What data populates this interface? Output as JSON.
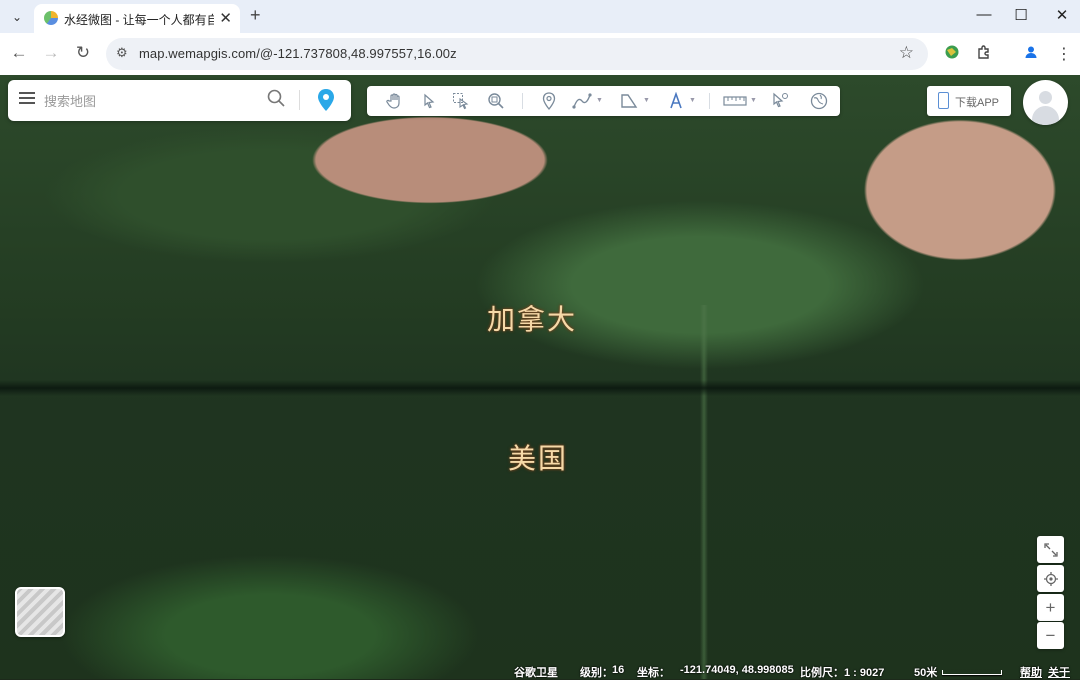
{
  "browser": {
    "tab_title": "水经微图 - 让每一个人都有自己的地图",
    "url": "map.wemapgis.com/@-121.737808,48.997557,16.00z"
  },
  "search": {
    "placeholder": "搜索地图"
  },
  "download": {
    "label": "下载APP"
  },
  "map": {
    "labels": {
      "north": "加拿大",
      "south": "美国"
    }
  },
  "toolbar": {
    "tools": [
      "pan-hand-icon",
      "select-arrow-icon",
      "box-select-icon",
      "zoom-search-icon",
      "marker-icon",
      "polyline-icon",
      "polygon-icon",
      "text-icon",
      "ruler-icon",
      "pointer-info-icon",
      "globe-icon"
    ]
  },
  "status": {
    "basemap": "谷歌卫星",
    "level_label": "级别：",
    "level": "16",
    "coord_label": "坐标：",
    "coords": "-121.74049, 48.998085",
    "scale_label": "比例尺：1 : 9027",
    "scale_dist": "50米",
    "help": "帮助",
    "about": "关于"
  },
  "controls": {
    "zoom_in": "+",
    "zoom_out": "−"
  }
}
